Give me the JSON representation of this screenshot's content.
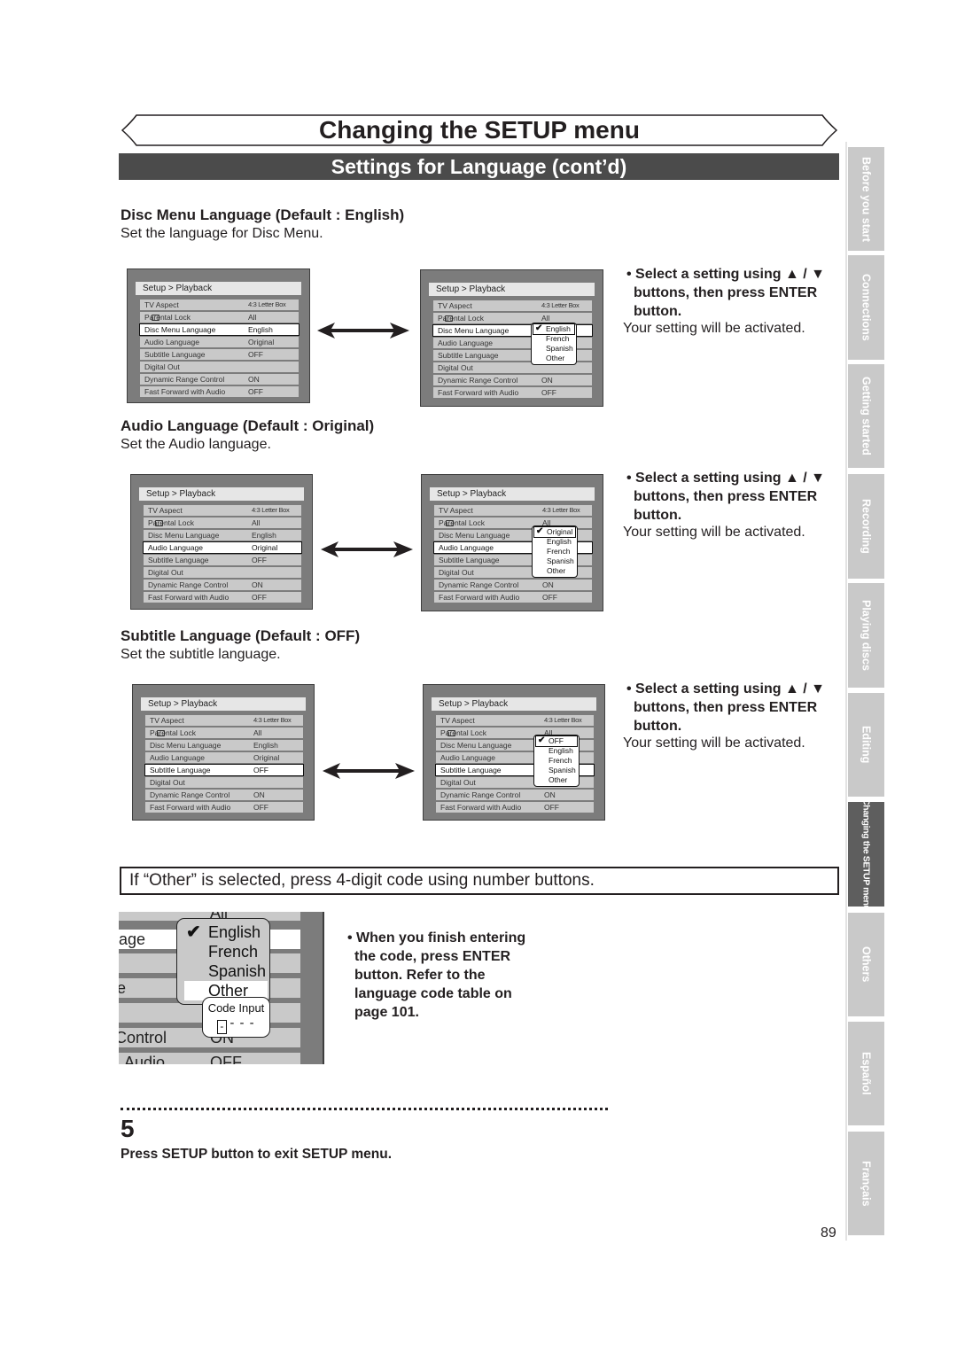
{
  "page": {
    "title": "Changing the SETUP menu",
    "subtitle": "Settings for Language (cont’d)",
    "page_number": "89"
  },
  "sections": [
    {
      "heading": "Disc Menu Language (Default : English)",
      "description": "Set the language for Disc Menu.",
      "instruction_bold": "• Select a setting using ▲ / ▼ buttons, then press ENTER button.",
      "instruction_normal": "Your setting will be activated.",
      "popup_options": [
        "English",
        "French",
        "Spanish",
        "Other"
      ],
      "popup_checked": "English"
    },
    {
      "heading": "Audio Language (Default : Original)",
      "description": "Set the Audio language.",
      "instruction_bold": "• Select a setting using ▲ / ▼ buttons, then press ENTER button.",
      "instruction_normal": "Your setting will be activated.",
      "popup_options": [
        "Original",
        "English",
        "French",
        "Spanish",
        "Other"
      ],
      "popup_checked": "Original"
    },
    {
      "heading": "Subtitle Language (Default : OFF)",
      "description": "Set the subtitle language.",
      "instruction_bold": "• Select a setting using ▲ / ▼ buttons, then press ENTER button.",
      "instruction_normal": "Your setting will be activated.",
      "popup_options": [
        "OFF",
        "English",
        "French",
        "Spanish",
        "Other"
      ],
      "popup_checked": "OFF"
    }
  ],
  "menu": {
    "header": "Setup > Playback",
    "rows": [
      {
        "label": "TV Aspect",
        "value": "4:3 Letter Box"
      },
      {
        "label": "Parental Lock",
        "value": "All"
      },
      {
        "label": "Disc Menu Language",
        "value": "English"
      },
      {
        "label": "Audio Language",
        "value": "Original"
      },
      {
        "label": "Subtitle Language",
        "value": "OFF"
      },
      {
        "label": "Digital Out",
        "value": ""
      },
      {
        "label": "Dynamic Range Control",
        "value": "ON"
      },
      {
        "label": "Fast Forward with Audio",
        "value": "OFF"
      }
    ]
  },
  "other_note": "If “Other” is selected, press 4-digit code using number buttons.",
  "code_example": {
    "row_fragments": [
      "All",
      "age",
      "e",
      "Control",
      "Audio",
      "ON",
      "OFF"
    ],
    "options": [
      "English",
      "French",
      "Spanish",
      "Other"
    ],
    "checked": "English",
    "highlighted": "Other",
    "code_label": "Code Input",
    "code_value": "- - -",
    "cursor": "-"
  },
  "code_instruction": "• When you finish entering the code, press ENTER button. Refer to the language code table on page 101.",
  "step": {
    "number": "5",
    "text": "Press SETUP button to exit SETUP menu."
  },
  "side_tabs": [
    {
      "label": "Before you start",
      "active": false
    },
    {
      "label": "Connections",
      "active": false
    },
    {
      "label": "Getting started",
      "active": false
    },
    {
      "label": "Recording",
      "active": false
    },
    {
      "label": "Playing discs",
      "active": false
    },
    {
      "label": "Editing",
      "active": false
    },
    {
      "label": "Changing the SETUP menu",
      "active": true
    },
    {
      "label": "Others",
      "active": false
    },
    {
      "label": "Español",
      "active": false
    },
    {
      "label": "Français",
      "active": false
    }
  ]
}
